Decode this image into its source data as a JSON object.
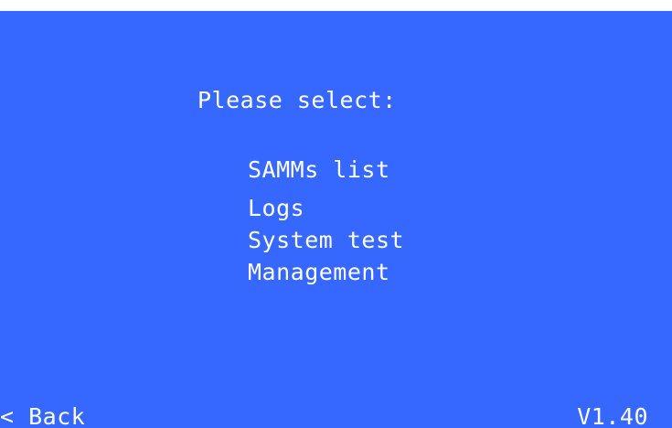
{
  "prompt": "Please select:",
  "menu": {
    "items": [
      {
        "label": "SAMMs list"
      },
      {
        "label": "Logs"
      },
      {
        "label": "System test"
      },
      {
        "label": "Management"
      }
    ]
  },
  "footer": {
    "back_label": "< Back",
    "version": "V1.40"
  },
  "colors": {
    "background": "#3668ff",
    "text": "#ffffff"
  }
}
